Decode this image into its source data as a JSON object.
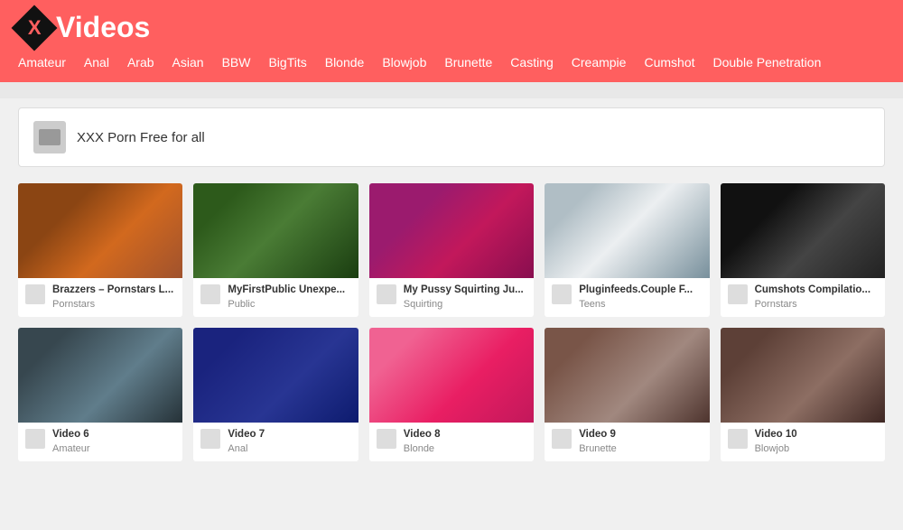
{
  "header": {
    "logo_x": "X",
    "logo_text": "Videos"
  },
  "nav": {
    "items": [
      {
        "label": "Amateur"
      },
      {
        "label": "Anal"
      },
      {
        "label": "Arab"
      },
      {
        "label": "Asian"
      },
      {
        "label": "BBW"
      },
      {
        "label": "BigTits"
      },
      {
        "label": "Blonde"
      },
      {
        "label": "Blowjob"
      },
      {
        "label": "Brunette"
      },
      {
        "label": "Casting"
      },
      {
        "label": "Creampie"
      },
      {
        "label": "Cumshot"
      },
      {
        "label": "Double Penetration"
      }
    ]
  },
  "banner": {
    "title": "XXX Porn Free for all"
  },
  "videos": [
    {
      "title": "Brazzers – Pornstars L...",
      "category": "Pornstars",
      "thumb_class": "thumb-1"
    },
    {
      "title": "MyFirstPublic Unexpe...",
      "category": "Public",
      "thumb_class": "thumb-2"
    },
    {
      "title": "My Pussy Squirting Ju...",
      "category": "Squirting",
      "thumb_class": "thumb-3"
    },
    {
      "title": "Pluginfeeds.Couple F...",
      "category": "Teens",
      "thumb_class": "thumb-4"
    },
    {
      "title": "Cumshots Compilatio...",
      "category": "Pornstars",
      "thumb_class": "thumb-5"
    },
    {
      "title": "Video 6",
      "category": "Amateur",
      "thumb_class": "thumb-6"
    },
    {
      "title": "Video 7",
      "category": "Anal",
      "thumb_class": "thumb-7"
    },
    {
      "title": "Video 8",
      "category": "Blonde",
      "thumb_class": "thumb-8"
    },
    {
      "title": "Video 9",
      "category": "Brunette",
      "thumb_class": "thumb-9"
    },
    {
      "title": "Video 10",
      "category": "Blowjob",
      "thumb_class": "thumb-10"
    }
  ]
}
